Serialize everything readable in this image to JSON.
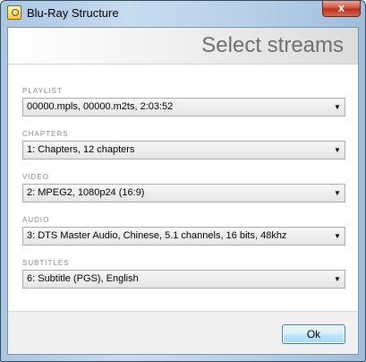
{
  "window": {
    "title": "Blu-Ray Structure",
    "close_label": "x"
  },
  "header": {
    "title": "Select streams"
  },
  "sections": {
    "playlist": {
      "label": "PLAYLIST",
      "value": "00000.mpls, 00000.m2ts, 2:03:52"
    },
    "chapters": {
      "label": "CHAPTERS",
      "value": "1: Chapters, 12 chapters"
    },
    "video": {
      "label": "VIDEO",
      "value": "2: MPEG2, 1080p24 (16:9)"
    },
    "audio": {
      "label": "AUDIO",
      "value": "3: DTS Master Audio, Chinese, 5.1 channels, 16 bits, 48khz"
    },
    "subtitles": {
      "label": "SUBTITLES",
      "value": "6: Subtitle (PGS), English"
    }
  },
  "footer": {
    "ok_label": "Ok"
  },
  "icons": {
    "dropdown": "chevron-down-icon",
    "app": "app-icon",
    "close": "close-icon"
  }
}
